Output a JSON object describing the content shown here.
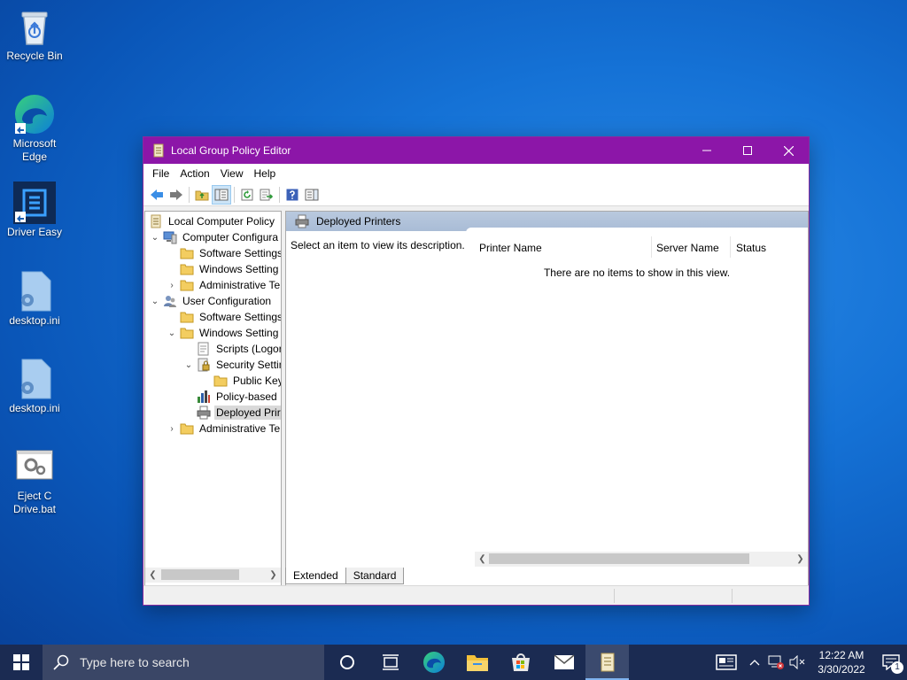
{
  "desktop": {
    "icons": [
      {
        "label": "Recycle Bin"
      },
      {
        "label": "Microsoft Edge"
      },
      {
        "label": "Driver Easy"
      },
      {
        "label": "desktop.ini"
      },
      {
        "label": "desktop.ini"
      },
      {
        "label": "Eject C Drive.bat"
      }
    ]
  },
  "window": {
    "title": "Local Group Policy Editor",
    "accent_color": "#8c16a8",
    "menu": [
      "File",
      "Action",
      "View",
      "Help"
    ],
    "tree": [
      {
        "label": "Local Computer Policy",
        "icon": "policy-icon"
      },
      {
        "label": "Computer Configura",
        "icon": "computer-icon",
        "expanded": true
      },
      {
        "label": "Software Settings",
        "icon": "folder-icon"
      },
      {
        "label": "Windows Setting",
        "icon": "folder-icon"
      },
      {
        "label": "Administrative Te",
        "icon": "folder-icon",
        "expandable": true
      },
      {
        "label": "User Configuration",
        "icon": "users-icon",
        "expanded": true
      },
      {
        "label": "Software Settings",
        "icon": "folder-icon"
      },
      {
        "label": "Windows Setting",
        "icon": "folder-icon",
        "expanded": true
      },
      {
        "label": "Scripts (Logor",
        "icon": "script-icon"
      },
      {
        "label": "Security Settin",
        "icon": "security-icon",
        "expanded": true
      },
      {
        "label": "Public Key",
        "icon": "folder-icon"
      },
      {
        "label": "Policy-based",
        "icon": "chart-icon"
      },
      {
        "label": "Deployed Prir",
        "icon": "printer-icon",
        "selected": true
      },
      {
        "label": "Administrative Te",
        "icon": "folder-icon",
        "expandable": true
      }
    ],
    "right": {
      "header": "Deployed Printers",
      "description": "Select an item to view its description.",
      "columns": [
        "Printer Name",
        "Server Name",
        "Status"
      ],
      "empty_message": "There are no items to show in this view."
    },
    "tabs": [
      "Extended",
      "Standard"
    ]
  },
  "taskbar": {
    "search_placeholder": "Type here to search",
    "time": "12:22 AM",
    "date": "3/30/2022",
    "notification_count": "1"
  }
}
